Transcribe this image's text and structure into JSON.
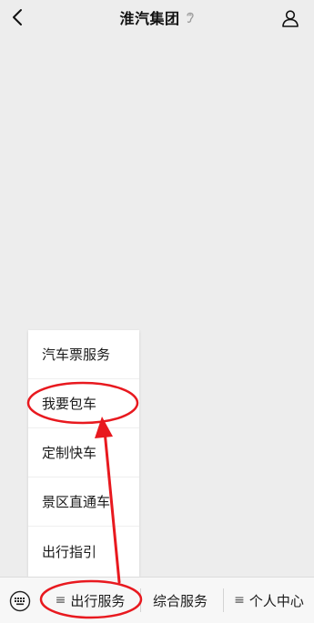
{
  "header": {
    "title": "淮汽集团",
    "back_icon": "chevron-left-icon",
    "ear_icon": "ear-icon",
    "profile_icon": "person-icon"
  },
  "popup_menu": {
    "items": [
      {
        "label": "汽车票服务"
      },
      {
        "label": "我要包车"
      },
      {
        "label": "定制快车"
      },
      {
        "label": "景区直通车"
      },
      {
        "label": "出行指引"
      }
    ]
  },
  "tabbar": {
    "keyboard_icon": "keyboard-icon",
    "menu_glyph": "≡",
    "tabs": [
      {
        "label": "出行服务",
        "has_menu_glyph": true
      },
      {
        "label": "综合服务",
        "has_menu_glyph": false
      },
      {
        "label": "个人中心",
        "has_menu_glyph": true
      }
    ]
  },
  "annotation": {
    "color": "#e8191f",
    "highlighted_items": [
      "我要包车",
      "出行服务"
    ]
  }
}
